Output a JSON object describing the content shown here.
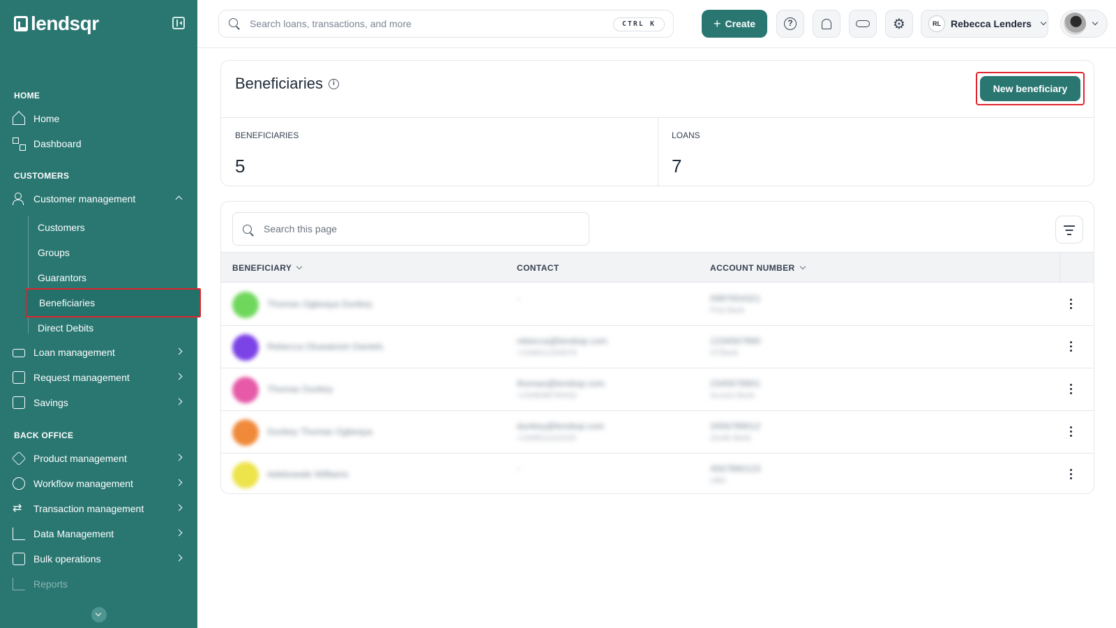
{
  "app": {
    "logo_text": "lendsqr"
  },
  "sidebar": {
    "sections": {
      "home": "HOME",
      "customers": "CUSTOMERS",
      "back_office": "BACK OFFICE"
    },
    "home_items": [
      "Home",
      "Dashboard"
    ],
    "customer_management": {
      "label": "Customer management",
      "children": [
        "Customers",
        "Groups",
        "Guarantors",
        "Beneficiaries",
        "Direct Debits"
      ],
      "active_child": "Beneficiaries"
    },
    "customer_items": [
      "Loan management",
      "Request management",
      "Savings"
    ],
    "back_office_items": [
      "Product management",
      "Workflow management",
      "Transaction management",
      "Data Management",
      "Bulk operations",
      "Reports"
    ]
  },
  "topbar": {
    "search_placeholder": "Search loans, transactions, and more",
    "shortcut": "CTRL K",
    "create_label": "Create",
    "user_initials": "RL",
    "user_name": "Rebecca Lenders"
  },
  "header": {
    "title": "Beneficiaries",
    "new_button_label": "New beneficiary",
    "stats": [
      {
        "label": "BENEFICIARIES",
        "value": "5"
      },
      {
        "label": "LOANS",
        "value": "7"
      }
    ]
  },
  "table": {
    "search_placeholder": "Search this page",
    "columns": [
      "BENEFICIARY",
      "CONTACT",
      "ACCOUNT NUMBER"
    ],
    "rows": [
      {
        "color": "#6fd85c",
        "name": "Thomas Ogbeaya Dunkey",
        "contact": "-",
        "contact_sub": "",
        "account": "0987654321",
        "account_sub": "First Bank"
      },
      {
        "color": "#7b42e6",
        "name": "Rebecca Oluwatosin Daniels",
        "contact": "rebecca@lendsqr.com",
        "contact_sub": "+2348012345678",
        "account": "1234567890",
        "account_sub": "GTBank"
      },
      {
        "color": "#e65aa8",
        "name": "Thomas Dunkey",
        "contact": "thomas@lendsqr.com",
        "contact_sub": "+2348098765432",
        "account": "2345678901",
        "account_sub": "Access Bank"
      },
      {
        "color": "#f08a3a",
        "name": "Dunkey Thomas Ogbeaya",
        "contact": "dunkey@lendsqr.com",
        "contact_sub": "+2348011122233",
        "account": "3456789012",
        "account_sub": "Zenith Bank"
      },
      {
        "color": "#ede34a",
        "name": "Adebowale Williams",
        "contact": "-",
        "contact_sub": "",
        "account": "4567890123",
        "account_sub": "UBA"
      }
    ]
  }
}
